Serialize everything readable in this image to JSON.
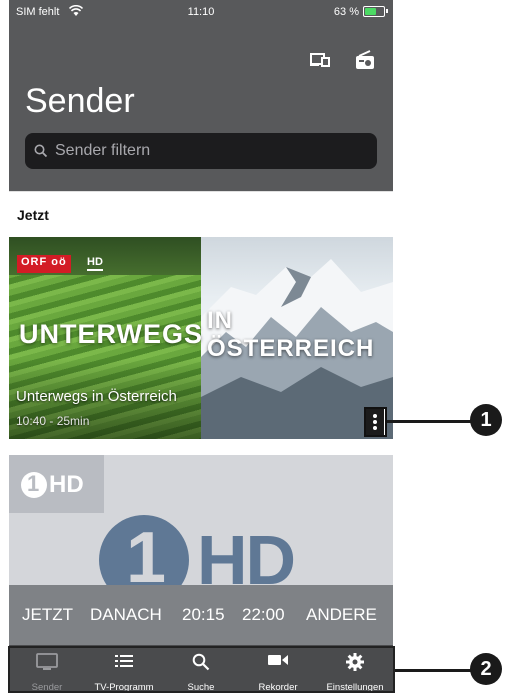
{
  "statusbar": {
    "carrier": "SIM fehlt",
    "time": "11:10",
    "battery": "63 %",
    "battery_level": 0.63
  },
  "header": {
    "title": "Sender",
    "search_placeholder": "Sender filtern",
    "icons": [
      "cast-icon",
      "radio-icon"
    ]
  },
  "section": {
    "label": "Jetzt"
  },
  "channels": [
    {
      "logo": "ORF",
      "logo_sub": "oö",
      "hd": "HD",
      "title_left": "UNTERWEGS",
      "title_right_1": "IN",
      "title_right_2": "ÖSTERREICH",
      "show": "Unterwegs in Österreich",
      "time": "10:40 - 25min"
    },
    {
      "badge": "HD",
      "big": "HD"
    }
  ],
  "timebar": [
    "JETZT",
    "DANACH",
    "20:15",
    "22:00",
    "ANDERE"
  ],
  "tabs": [
    {
      "label": "Sender",
      "icon": "tv-icon"
    },
    {
      "label": "TV-Programm",
      "icon": "list-icon"
    },
    {
      "label": "Suche",
      "icon": "search-icon"
    },
    {
      "label": "Rekorder",
      "icon": "camera-icon"
    },
    {
      "label": "Einstellungen",
      "icon": "gear-icon"
    }
  ],
  "callouts": [
    "1",
    "2"
  ],
  "colors": {
    "header": "#58595b",
    "tabbar": "#4a4b4d",
    "orf_red": "#d31c25",
    "accent_green": "#4cd964"
  }
}
